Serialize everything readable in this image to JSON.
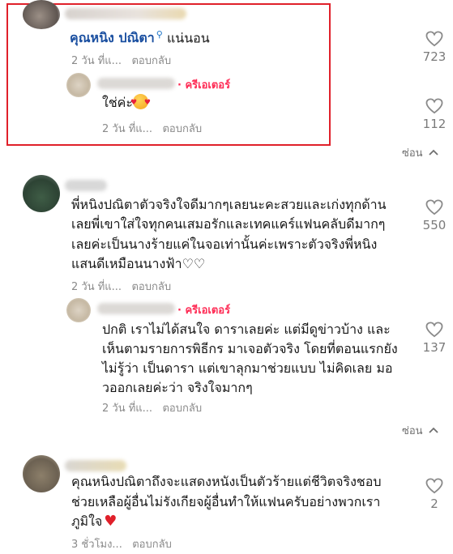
{
  "comments": [
    {
      "author": "คุณหนิง ปณิตา",
      "text": "แน่นอน",
      "time": "2 วัน ที่แ...",
      "reply_label": "ตอบกลับ",
      "likes": "723",
      "reply": {
        "creator_label": "· ครีเอเตอร์",
        "text": "ใช่ค่ะ",
        "time": "2 วัน ที่แ...",
        "reply_label": "ตอบกลับ",
        "likes": "112"
      },
      "hide_label": "ซ่อน"
    },
    {
      "lines": [
        "พี่หนิงปณิตาตัวจริงใจดีมากๆเลยนะคะสวยและเก่งทุกด้าน",
        "เลยพี่เขาใส่ใจทุกคนเสมอรักและเทคแคร์แฟนคลับดีมากๆ",
        "เลยค่ะเป็นนางร้ายแค่ในจอเท่านั้นค่ะเพราะตัวจริงพี่หนิง",
        "แสนดีเหมือนนางฟ้า♡♡"
      ],
      "time": "2 วัน ที่แ...",
      "reply_label": "ตอบกลับ",
      "likes": "550",
      "reply": {
        "creator_label": "· ครีเอเตอร์",
        "lines": [
          "ปกติ เราไม่ได้สนใจ ดาราเลยค่ะ แต่มีดูข่าวบ้าง และ",
          "เห็นตามรายการพิธีกร มาเจอตัวจริง โดยที่ตอนแรกยัง",
          "ไม่รู้ว่า เป็นดารา แต่เขาลุกมาช่วยแบบ ไม่คิดเลย มอ",
          "วออกเลยค่ะว่า จริงใจมากๆ"
        ],
        "time": "2 วัน ที่แ...",
        "reply_label": "ตอบกลับ",
        "likes": "137"
      },
      "hide_label": "ซ่อน"
    },
    {
      "lines": [
        "คุณหนิงปณิตาถึงจะแสดงหนังเป็นตัวร้ายแต่ชีวิตจริงชอบ",
        "ช่วยเหลือผู้อื่นไม่รังเกียจผู้อื่นทำให้แฟนครับอย่างพวกเรา",
        "ภูมิใจ"
      ],
      "time": "3 ชั่วโมง...",
      "reply_label": "ตอบกลับ",
      "likes": "2"
    }
  ],
  "colors": {
    "highlight_border": "#e0202a",
    "creator": "#fe2c55",
    "meta": "#8a8a8a",
    "author_link": "#1a4fa0"
  },
  "icons": {
    "like": "heart-outline-icon",
    "hide": "chevron-up-icon",
    "emoji_love": "smiling-face-with-hearts",
    "emoji_red_heart": "red-heart"
  }
}
